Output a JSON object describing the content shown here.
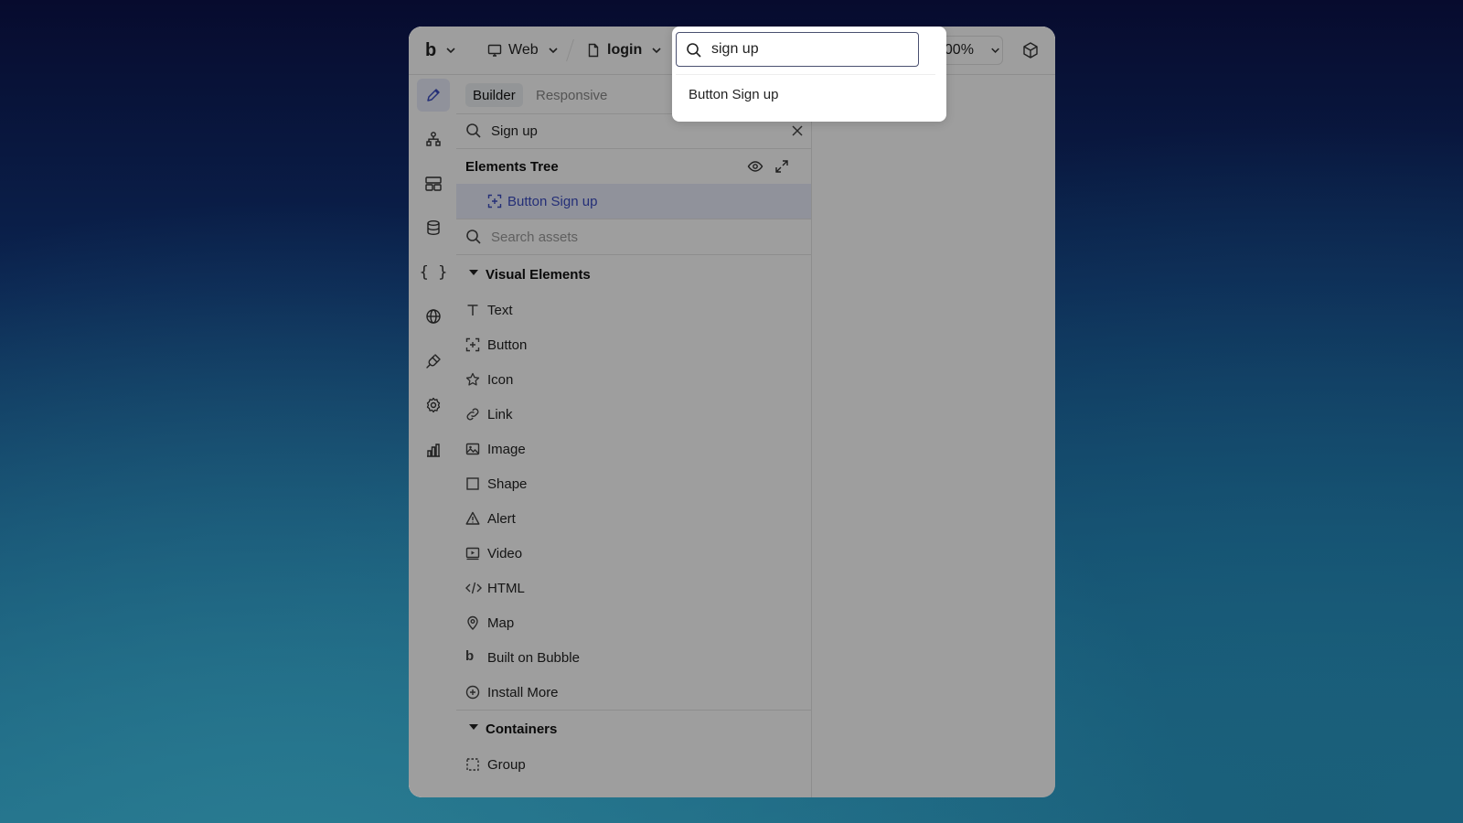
{
  "topbar": {
    "logo_text": "b",
    "platform_label": "Web",
    "page_label": "login",
    "zoom_label": "100%"
  },
  "rail": {
    "items": [
      "edit-icon",
      "workflow-icon",
      "styles-icon",
      "database-icon",
      "braces-icon",
      "globe-icon",
      "plugin-icon",
      "settings-icon",
      "analytics-icon"
    ]
  },
  "panel": {
    "tabs": {
      "builder": "Builder",
      "responsive": "Responsive"
    },
    "element_search_value": "Sign up",
    "elements_tree_title": "Elements Tree",
    "tree_selected_item": "Button Sign up",
    "assets_search_placeholder": "Search assets",
    "visual_elements_title": "Visual Elements",
    "visual_elements": [
      {
        "label": "Text",
        "icon": "text-icon"
      },
      {
        "label": "Button",
        "icon": "button-icon"
      },
      {
        "label": "Icon",
        "icon": "star-icon"
      },
      {
        "label": "Link",
        "icon": "link-icon"
      },
      {
        "label": "Image",
        "icon": "image-icon"
      },
      {
        "label": "Shape",
        "icon": "square-icon"
      },
      {
        "label": "Alert",
        "icon": "alert-icon"
      },
      {
        "label": "Video",
        "icon": "video-icon"
      },
      {
        "label": "HTML",
        "icon": "code-icon"
      },
      {
        "label": "Map",
        "icon": "map-pin-icon"
      },
      {
        "label": "Built on Bubble",
        "icon": "bubble-icon"
      },
      {
        "label": "Install More",
        "icon": "plus-circle-icon"
      }
    ],
    "containers_title": "Containers",
    "containers": [
      {
        "label": "Group",
        "icon": "group-icon"
      }
    ]
  },
  "search_popup": {
    "query": "sign up",
    "results": [
      "Button Sign up"
    ]
  }
}
